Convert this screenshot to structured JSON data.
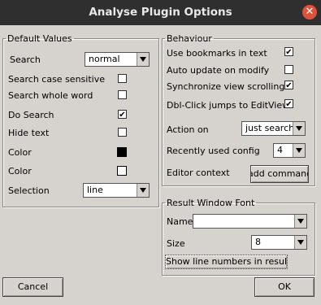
{
  "window": {
    "title": "Analyse Plugin Options",
    "close_glyph": "✕"
  },
  "default_values": {
    "legend": "Default Values",
    "search_label": "Search",
    "search_value": "normal",
    "search_case_label": "Search case sensitive",
    "search_whole_label": "Search whole word",
    "do_search_label": "Do Search",
    "hide_text_label": "Hide text",
    "color1_label": "Color",
    "color1_value": "#000000",
    "color2_label": "Color",
    "color2_value": "#ffffff",
    "selection_label": "Selection",
    "selection_value": "line",
    "search_case_checked": false,
    "search_whole_checked": false,
    "do_search_checked": true,
    "hide_text_checked": false
  },
  "behaviour": {
    "legend": "Behaviour",
    "bookmarks_label": "Use bookmarks in text",
    "bookmarks_checked": true,
    "auto_update_label": "Auto update on modify",
    "auto_update_checked": false,
    "sync_label": "Synchronize view scrolling",
    "sync_checked": true,
    "dblclick_label": "Dbl-Click jumps to EditView",
    "dblclick_checked": true,
    "action_label": "Action on",
    "action_value": "just search",
    "recent_label": "Recently used config",
    "recent_value": "4",
    "editor_label": "Editor context",
    "editor_button": "add command"
  },
  "result_font": {
    "legend": "Result Window Font",
    "name_label": "Name",
    "name_value": "",
    "size_label": "Size",
    "size_value": "8",
    "line_numbers_button": "Show line numbers in result"
  },
  "footer": {
    "cancel_label": "Cancel",
    "ok_label": "OK"
  }
}
